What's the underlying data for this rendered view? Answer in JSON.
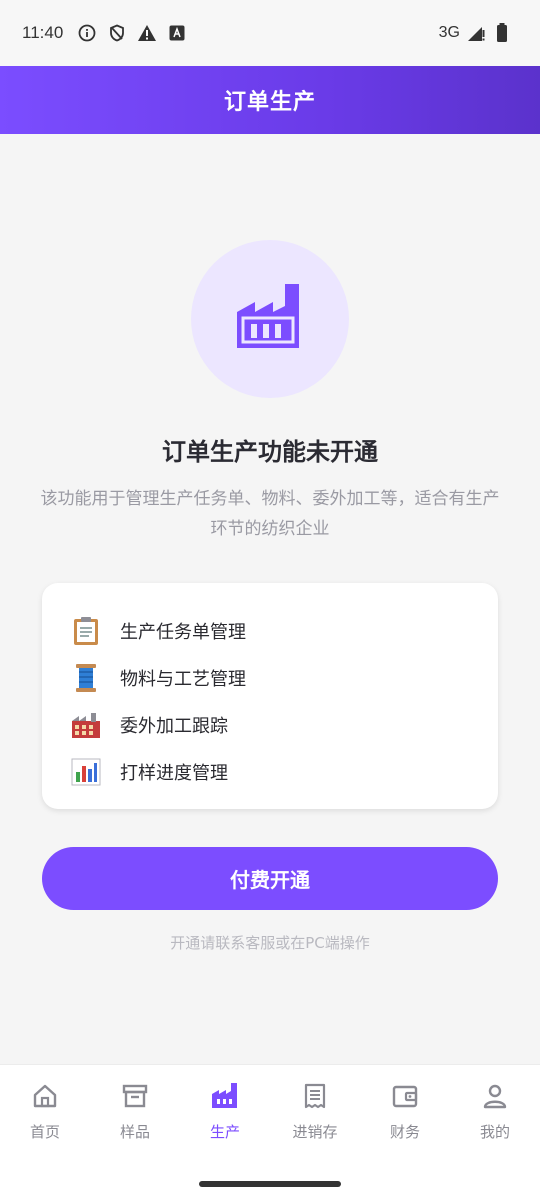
{
  "status_bar": {
    "time": "11:40",
    "network": "3G",
    "icons": [
      "info-icon",
      "shield-icon",
      "warning-icon",
      "a-icon",
      "signal-icon",
      "battery-icon"
    ]
  },
  "header": {
    "title": "订单生产"
  },
  "main": {
    "hero_icon": "factory-icon",
    "title": "订单生产功能未开通",
    "description": "该功能用于管理生产任务单、物料、委外加工等，适合有生产环节的纺织企业",
    "features": [
      {
        "icon": "clipboard-icon",
        "label": "生产任务单管理"
      },
      {
        "icon": "spool-icon",
        "label": "物料与工艺管理"
      },
      {
        "icon": "factory-icon",
        "label": "委外加工跟踪"
      },
      {
        "icon": "bar-chart-icon",
        "label": "打样进度管理"
      }
    ],
    "pay_button": "付费开通",
    "hint": "开通请联系客服或在PC端操作"
  },
  "tab_bar": {
    "items": [
      {
        "icon": "home-icon",
        "label": "首页",
        "active": false
      },
      {
        "icon": "box-icon",
        "label": "样品",
        "active": false
      },
      {
        "icon": "factory-icon",
        "label": "生产",
        "active": true
      },
      {
        "icon": "receipt-icon",
        "label": "进销存",
        "active": false
      },
      {
        "icon": "wallet-icon",
        "label": "财务",
        "active": false
      },
      {
        "icon": "person-icon",
        "label": "我的",
        "active": false
      }
    ]
  },
  "colors": {
    "accent": "#7c4dff",
    "header_gradient_start": "#7b4dff",
    "header_gradient_end": "#5b32cc",
    "hero_circle_bg": "#ece6ff"
  }
}
